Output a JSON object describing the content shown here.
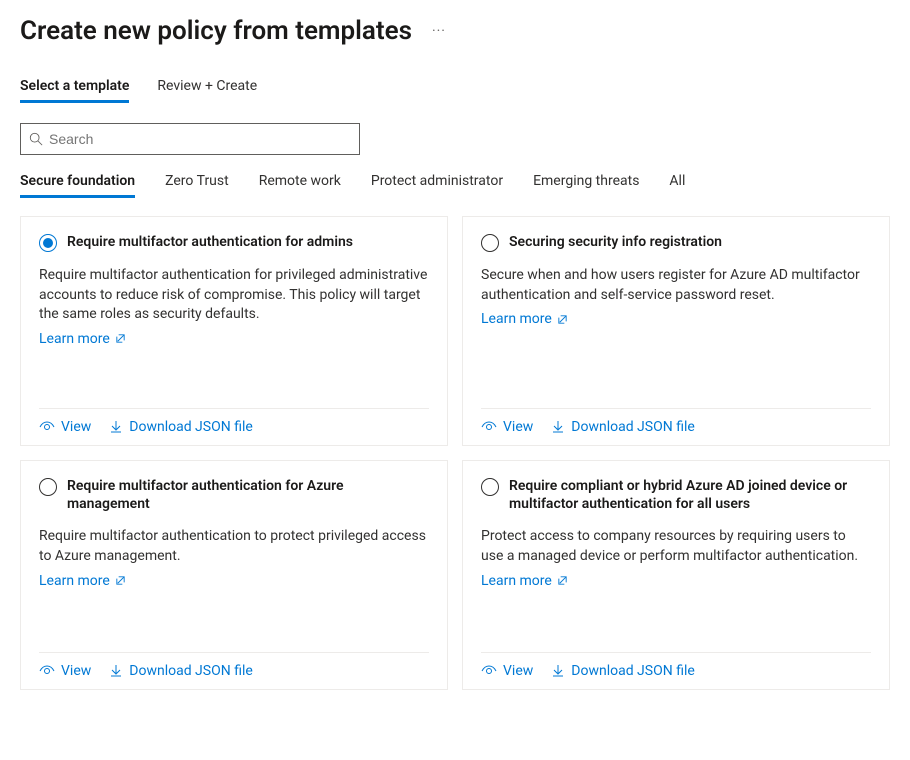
{
  "header": {
    "title": "Create new policy from templates"
  },
  "wizard_tabs": [
    {
      "label": "Select a template",
      "active": true
    },
    {
      "label": "Review + Create",
      "active": false
    }
  ],
  "search": {
    "placeholder": "Search",
    "value": ""
  },
  "category_tabs": [
    {
      "label": "Secure foundation",
      "active": true
    },
    {
      "label": "Zero Trust",
      "active": false
    },
    {
      "label": "Remote work",
      "active": false
    },
    {
      "label": "Protect administrator",
      "active": false
    },
    {
      "label": "Emerging threats",
      "active": false
    },
    {
      "label": "All",
      "active": false
    }
  ],
  "common": {
    "learn_more": "Learn more",
    "view": "View",
    "download": "Download JSON file"
  },
  "cards": [
    {
      "title": "Require multifactor authentication for admins",
      "description": "Require multifactor authentication for privileged administrative accounts to reduce risk of compromise. This policy will target the same roles as security defaults.",
      "selected": true
    },
    {
      "title": "Securing security info registration",
      "description": "Secure when and how users register for Azure AD multifactor authentication and self-service password reset.",
      "selected": false
    },
    {
      "title": "Require multifactor authentication for Azure management",
      "description": "Require multifactor authentication to protect privileged access to Azure management.",
      "selected": false
    },
    {
      "title": "Require compliant or hybrid Azure AD joined device or multifactor authentication for all users",
      "description": "Protect access to company resources by requiring users to use a managed device or perform multifactor authentication.",
      "selected": false
    }
  ]
}
